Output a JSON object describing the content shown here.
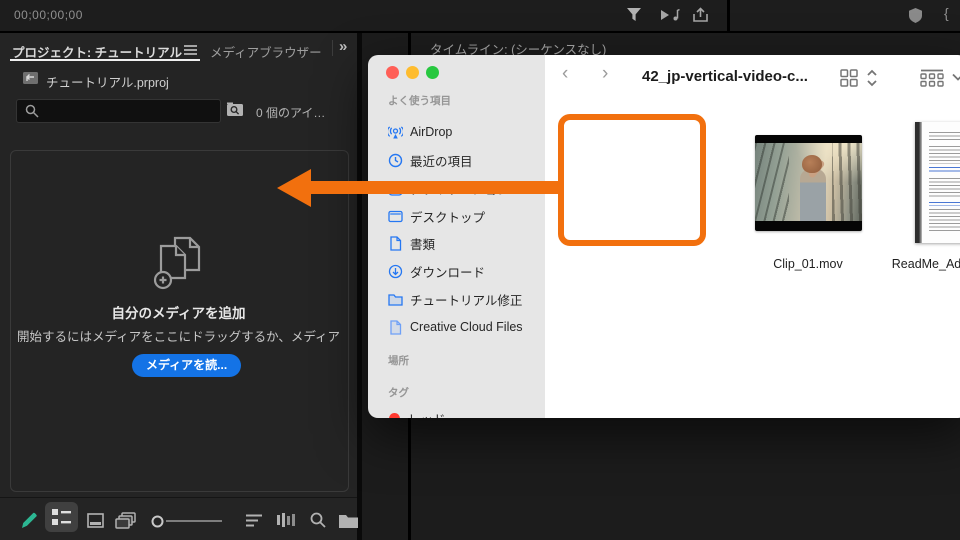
{
  "premiere": {
    "top_bar": {
      "timecode": "00;00;00;00",
      "icons": [
        "filter-icon",
        "audio-preview-icon",
        "quick-export-icon",
        "shield-icon",
        "panel-edge-icon"
      ]
    },
    "project_panel": {
      "tabs": [
        {
          "label": "プロジェクト: チュートリアル",
          "active": true
        },
        {
          "label": "メディアブラウザー",
          "active": false
        }
      ],
      "tab_overflow": "»",
      "bin_path": "チュートリアル.prproj",
      "search": {
        "placeholder": "",
        "value": ""
      },
      "item_count": "0 個のアイ…",
      "empty_state": {
        "title": "自分のメディアを追加",
        "subtitle": "開始するにはメディアをここにドラッグするか、メディア",
        "button_label": "メディアを読..."
      },
      "toolbar": [
        "writable-pencil",
        "list-view",
        "icon-view",
        "freeform-view",
        "zoom-slider",
        "sort",
        "automate-to-sequence",
        "find",
        "new-bin"
      ]
    },
    "timeline_panel": {
      "tab": "タイムライン: (シーケンスなし)"
    }
  },
  "finder": {
    "title": "42_jp-vertical-video-c...",
    "nav": {
      "back": "‹",
      "forward": "›"
    },
    "sidebar": {
      "favorites": {
        "header": "よく使う項目",
        "items": [
          "AirDrop",
          "最近の項目",
          "アプリケーション",
          "デスクトップ",
          "書類",
          "ダウンロード",
          "チュートリアル修正",
          "Creative Cloud Files"
        ]
      },
      "locations": {
        "header": "場所"
      },
      "tags": {
        "header": "タグ",
        "items": [
          "レッド"
        ]
      }
    },
    "files": [
      {
        "name": "Clip_01.mov",
        "type": "video"
      },
      {
        "name": "ReadMe_AdobeStock.pdf",
        "type": "pdf"
      }
    ]
  },
  "annotation": {
    "highlight_color": "#F2700E"
  },
  "colors": {
    "accent_orange": "#F2700E",
    "import_button_blue": "#1473E6",
    "sidebar_icon_blue": "#2577F2",
    "traffic_red": "#FF5F57",
    "traffic_yellow": "#FEBC2E",
    "traffic_green": "#28C840",
    "pencil_green": "#2CB793"
  }
}
